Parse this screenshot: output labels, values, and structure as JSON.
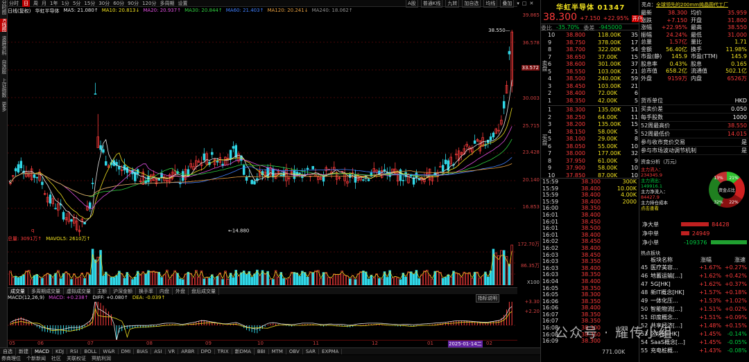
{
  "left_toolbar": [
    "分时图",
    "K线图",
    "滚屏资料",
    "自选股",
    "上证指数",
    "更多"
  ],
  "toolbar": {
    "periods": [
      "分时",
      "日",
      "周",
      "月",
      "1年",
      "1分",
      "5分",
      "15分",
      "30分",
      "60分",
      "90分",
      "120分",
      "多周期",
      "设置"
    ],
    "active_period": "日",
    "right_items": [
      "A股",
      "普通K线",
      "九转",
      "加自选",
      "均线",
      "叠加"
    ]
  },
  "ma_legend": {
    "adjust": "日线(复权)",
    "name": "华虹半导体",
    "items": [
      {
        "label": "MA5: 21.080↑",
        "color": "#e8e8e8"
      },
      {
        "label": "MA10: 20.813↓",
        "color": "#f0e020"
      },
      {
        "label": "MA20: 20.937↑",
        "color": "#e050e0"
      },
      {
        "label": "MA30: 20.844↑",
        "color": "#30d040"
      },
      {
        "label": "MA60: 21.403↑",
        "color": "#4080ff"
      },
      {
        "label": "MA120: 20.241↓",
        "color": "#e8a040"
      },
      {
        "label": "MA240: 18.062↑",
        "color": "#909090"
      }
    ]
  },
  "price_axis": [
    "39.865",
    "36.578",
    "33.572",
    "30.003",
    "25.715",
    "23.428",
    "20.140",
    "16.853"
  ],
  "annotations": {
    "high": "38.550",
    "low": "14.880",
    "q_mark": "q"
  },
  "volume_legend": {
    "total": "总量: 3091万↑",
    "mavol": "MAVOL5: 2610万↑"
  },
  "volume_axis": [
    "172.70万",
    "86.35万",
    "X100"
  ],
  "indicator_tabs": [
    "成交量",
    "多周期成交量",
    "虚拟成交量",
    "主额",
    "沪深金额",
    "换手率",
    "内盘",
    "外盘",
    "盘后成交量"
  ],
  "macd_legend": {
    "macd": "MACD(12,26,9)",
    "val": "MACD: +0.238↑",
    "diff": "DIFF: +0.080↑",
    "dea": "DEA: -0.039↑"
  },
  "macd_axis": [
    "+3.30",
    "+2.20"
  ],
  "indicator_btn": "指标说明",
  "x_axis": [
    "05",
    "06",
    "07",
    "08",
    "09",
    "10",
    "11",
    "12",
    "01",
    "2025-01-14二",
    "02"
  ],
  "bottom_tabs": [
    "自选",
    "新建",
    "MACD",
    "KDJ",
    "RSI",
    "BOLL",
    "W&R",
    "DMI",
    "BIAS",
    "ASI",
    "VR",
    "ARBR",
    "DPO",
    "TRIX",
    "新DMA",
    "BBI",
    "MTM",
    "OBV",
    "SAR",
    "EXPMA"
  ],
  "status_bar": [
    "券商理位",
    "个新新闻",
    "社区",
    "关联权证",
    "冥航利润"
  ],
  "quote": {
    "name": "华虹半导体 01347",
    "price": "38.300",
    "change": "+7.150",
    "pct": "+22.95%",
    "tag": "开户",
    "weibi": "-35.70%",
    "weicha": "-945000",
    "asks": [
      [
        "10",
        "38.800",
        "118.00K",
        "35"
      ],
      [
        "9",
        "38.750",
        "378.00K",
        "17"
      ],
      [
        "8",
        "38.700",
        "322.00K",
        "54"
      ],
      [
        "7",
        "38.650",
        "37.00K",
        "15"
      ],
      [
        "6",
        "38.600",
        "301.00K",
        "37"
      ],
      [
        "5",
        "38.550",
        "103.00K",
        "21"
      ],
      [
        "4",
        "38.500",
        "240.00K",
        "59"
      ],
      [
        "3",
        "38.450",
        "103.00K",
        "21"
      ],
      [
        "2",
        "38.400",
        "72.00K",
        "6"
      ],
      [
        "1",
        "38.350",
        "42.00K",
        "5"
      ]
    ],
    "bids": [
      [
        "1",
        "38.300",
        "135.00K",
        "11"
      ],
      [
        "2",
        "38.250",
        "64.00K",
        "11"
      ],
      [
        "3",
        "38.200",
        "135.00K",
        "15"
      ],
      [
        "4",
        "38.150",
        "58.00K",
        "5"
      ],
      [
        "5",
        "38.100",
        "29.00K",
        "8"
      ],
      [
        "6",
        "38.050",
        "55.00K",
        "10"
      ],
      [
        "7",
        "38.000",
        "177.00K",
        "32"
      ],
      [
        "8",
        "37.950",
        "61.00K",
        "9"
      ],
      [
        "9",
        "37.900",
        "58.00K",
        "10"
      ],
      [
        "10",
        "37.850",
        "87.00K",
        "10"
      ]
    ],
    "ask_label": "卖盘",
    "bid_label": "买盘"
  },
  "ticks": [
    [
      "15:59",
      "38.300",
      "300K"
    ],
    [
      "15:59",
      "38.400",
      "10.00K"
    ],
    [
      "15:59",
      "38.400",
      "4.00K"
    ],
    [
      "15:59",
      "38.400",
      "2000"
    ],
    [
      "16:00",
      "38.350",
      ""
    ],
    [
      "16:01",
      "38.400",
      ""
    ],
    [
      "16:01",
      "38.450",
      ""
    ],
    [
      "16:01",
      "38.500",
      ""
    ],
    [
      "16:01",
      "38.400",
      ""
    ],
    [
      "16:02",
      "38.450",
      ""
    ],
    [
      "16:02",
      "38.400",
      ""
    ],
    [
      "16:03",
      "38.450",
      ""
    ],
    [
      "16:03",
      "38.350",
      ""
    ],
    [
      "16:03",
      "38.400",
      ""
    ],
    [
      "16:03",
      "38.350",
      ""
    ],
    [
      "16:04",
      "38.400",
      ""
    ],
    [
      "16:05",
      "38.350",
      ""
    ],
    [
      "16:05",
      "38.300",
      ""
    ],
    [
      "16:06",
      "38.350",
      ""
    ],
    [
      "16:06",
      "38.400",
      ""
    ],
    [
      "16:07",
      "38.350",
      ""
    ],
    [
      "16:07",
      "38.350",
      ""
    ],
    [
      "16:08",
      "38.300",
      ""
    ],
    [
      "16:08",
      "38.350",
      ""
    ],
    [
      "16:09",
      "38.300",
      ""
    ]
  ],
  "tick_footer": "771.00K",
  "news": {
    "label": "亮点：",
    "text": "全球领先的200mm纯晶圆代工厂"
  },
  "stats": [
    [
      "最新",
      "38.300",
      "均价",
      "35.959"
    ],
    [
      "涨跌",
      "+7.150",
      "开盘",
      "31.800"
    ],
    [
      "涨幅",
      "+22.95%",
      "最高",
      "38.550"
    ],
    [
      "振幅",
      "24.24%",
      "最低",
      "31.000"
    ],
    [
      "总量",
      "1.57亿",
      "量比",
      "1.71"
    ],
    [
      "金额",
      "56.40亿",
      "换手",
      "11.98%"
    ],
    [
      "市盈(静)",
      "145.9",
      "市盈(TTM)",
      "145.9"
    ],
    [
      "股息率",
      "0.43%",
      "股息",
      "0.165"
    ],
    [
      "总市值",
      "658.2亿",
      "流通值",
      "502.1亿"
    ],
    [
      "外盘",
      "9159万",
      "内盘",
      "6526万"
    ]
  ],
  "info": [
    [
      "货币单位",
      "HKD"
    ],
    [
      "买卖价差",
      "0.050"
    ],
    [
      "每手股数",
      "1000"
    ],
    [
      "52周最高价",
      "38.550"
    ],
    [
      "52周最低价",
      "14.015"
    ],
    [
      "参与收市竞价交易",
      "是"
    ],
    [
      "参与市场波动调节机制",
      "是"
    ]
  ],
  "fund": {
    "title": "资金分析（万元）",
    "main_in_label": "主力流入：",
    "main_in": "234345.9",
    "main_out_label": "主力流出：",
    "main_out": "149916.1",
    "main_net_label": "主力净流入：",
    "main_net": "84427.9",
    "cost_label": "主力持仓成本",
    "cost_link": "点击查看",
    "donut_center": "资金占比",
    "donut_labels": [
      "13%",
      "21%",
      "32%",
      "22%"
    ]
  },
  "netflow": [
    [
      "净大单",
      "84428"
    ],
    [
      "净中单",
      "24949"
    ],
    [
      "净小单",
      "-109376"
    ]
  ],
  "sectors": {
    "title": "热点板块",
    "cols": [
      "板块名称",
      "涨幅",
      "涨速"
    ],
    "rows": [
      [
        "45",
        "医疗美容...",
        "+1.67%",
        "+0.27%"
      ],
      [
        "46",
        "地蓄运输[...]",
        "+1.62%",
        "+0.42%"
      ],
      [
        "47",
        "5G[HK]",
        "+1.62%",
        "+0.37%"
      ],
      [
        "48",
        "新IT概念[HK]",
        "+1.57%",
        "+0.18%"
      ],
      [
        "49",
        "一体化压...",
        "+1.53%",
        "+1.02%"
      ],
      [
        "50",
        "智能物流[...]",
        "+1.51%",
        "+0.02%"
      ],
      [
        "51",
        "印度概念...",
        "+1.51%",
        "+0.09%"
      ],
      [
        "52",
        "共享经济[...]",
        "+1.48%",
        "+0.15%"
      ],
      [
        "53",
        "区块链[HK]",
        "+1.45%",
        "-0.14%"
      ],
      [
        "54",
        "SaaS概念[...]",
        "+1.45%",
        "-0.05%"
      ],
      [
        "55",
        "充电桩概...",
        "+1.43%",
        "-0.08%"
      ]
    ]
  },
  "watermark": "公众号 · 耀传小组",
  "chart_data": {
    "type": "candlestick",
    "title": "华虹半导体",
    "ylim": [
      14.0,
      39.9
    ],
    "low_label": 14.88,
    "high_label": 38.55,
    "x_ticks": [
      "05",
      "06",
      "07",
      "08",
      "09",
      "10",
      "11",
      "12",
      "01",
      "02"
    ]
  },
  "colors": {
    "up": "#ff3c3c",
    "down": "#30d8e8",
    "bg": "#000000",
    "grid": "#5a0a0a"
  }
}
